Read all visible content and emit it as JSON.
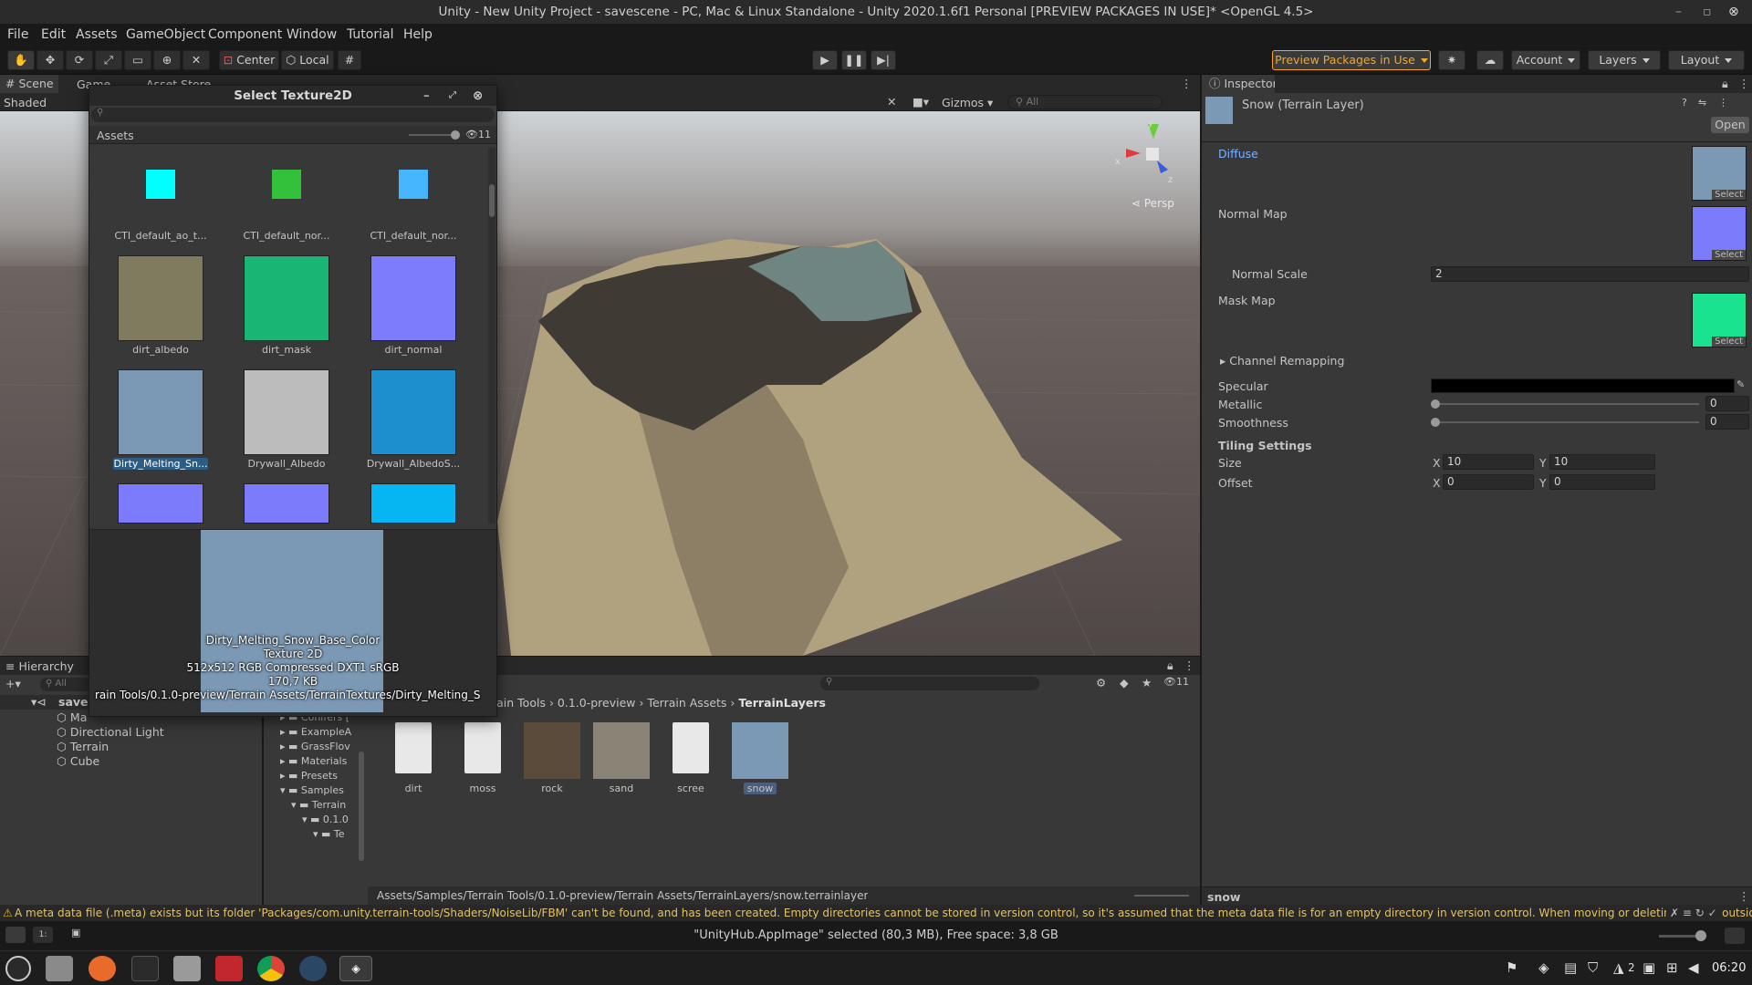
{
  "window": {
    "title": "Unity - New Unity Project - savescene - PC, Mac & Linux Standalone - Unity 2020.1.6f1 Personal [PREVIEW PACKAGES IN USE]* <OpenGL 4.5>"
  },
  "menu": [
    "File",
    "Edit",
    "Assets",
    "GameObject",
    "Component",
    "Window",
    "Tutorial",
    "Help"
  ],
  "toolbar": {
    "center_label": "Center",
    "local_label": "Local",
    "preview_packages": "Preview Packages in Use",
    "account": "Account",
    "layers": "Layers",
    "layout": "Layout",
    "accent": "#f5a623"
  },
  "scene": {
    "tabs": [
      "Scene",
      "Game",
      "Asset Store"
    ],
    "shading": "Shaded",
    "gizmos": "Gizmos",
    "search_placeholder": "All",
    "persp": "Persp",
    "axis_x": "x",
    "axis_y": "y",
    "axis_z": "z"
  },
  "dialog": {
    "title": "Select Texture2D",
    "tab": "Assets",
    "count": "11",
    "items": [
      {
        "label": "CTI_default_ao_t...",
        "color": "#00ffff"
      },
      {
        "label": "CTI_default_nor...",
        "color": "#33c13b"
      },
      {
        "label": "CTI_default_nor...",
        "color": "#45b6ff"
      },
      {
        "label": "dirt_albedo",
        "color": "#807a5f"
      },
      {
        "label": "dirt_mask",
        "color": "#19b574"
      },
      {
        "label": "dirt_normal",
        "color": "#7d7cfc"
      },
      {
        "label": "Dirty_Melting_Sn...",
        "color": "#7b98b4"
      },
      {
        "label": "Drywall_Albedo",
        "color": "#bcbcbc"
      },
      {
        "label": "Drywall_AlbedoS...",
        "color": "#1d8fcf"
      },
      {
        "label": "",
        "color": "#7b7bfb"
      },
      {
        "label": "",
        "color": "#7b7bfb"
      },
      {
        "label": "",
        "color": "#06b6f2"
      }
    ],
    "preview": {
      "name": "Dirty_Melting_Snow_Base_Color",
      "type": "Texture 2D",
      "info": "512x512  RGB Compressed DXT1 sRGB",
      "size": "170,7 KB",
      "path": "rain Tools/0.1.0-preview/Terrain Assets/TerrainTextures/Dirty_Melting_S"
    }
  },
  "inspector": {
    "tab": "Inspector",
    "object_name": "Snow (Terrain Layer)",
    "open_button": "Open",
    "diffuse": "Diffuse",
    "normal_map": "Normal Map",
    "normal_scale_label": "Normal Scale",
    "normal_scale": "2",
    "mask_map": "Mask Map",
    "channel_remapping": "Channel Remapping",
    "specular": "Specular",
    "metallic": "Metallic",
    "metallic_value": "0",
    "smoothness": "Smoothness",
    "smoothness_value": "0",
    "tiling_settings": "Tiling Settings",
    "size_label": "Size",
    "size_x": "10",
    "size_y": "10",
    "offset_label": "Offset",
    "offset_x": "0",
    "offset_y": "0",
    "x": "X",
    "y": "Y",
    "select": "Select",
    "footer": "snow"
  },
  "hierarchy": {
    "tab": "Hierarchy",
    "search_placeholder": "All",
    "root": "saves",
    "items": [
      "Ma",
      "Directional Light",
      "Terrain",
      "Cube"
    ]
  },
  "project": {
    "breadcrumb": [
      "rain Tools",
      "0.1.0-preview",
      "Terrain Assets",
      "TerrainLayers"
    ],
    "tree": [
      "Conifers [",
      "ExampleA",
      "GrassFlov",
      "Materials",
      "Presets",
      "Samples",
      "Terrain",
      "0.1.0",
      "Te"
    ],
    "count": "11",
    "assets": [
      {
        "label": "dirt"
      },
      {
        "label": "moss"
      },
      {
        "label": "rock"
      },
      {
        "label": "sand"
      },
      {
        "label": "scree"
      },
      {
        "label": "snow"
      }
    ],
    "path": "Assets/Samples/Terrain Tools/0.1.0-preview/Terrain Assets/TerrainLayers/snow.terrainlayer"
  },
  "console": {
    "message": "A meta data file (.meta) exists but its folder 'Packages/com.unity.terrain-tools/Shaders/NoiseLib/FBM' can't be found, and has been created. Empty directories cannot be stored in version control, so it's assumed that the meta data file is for an empty directory in version control. When moving or deleting folders outside of Unit"
  },
  "status": {
    "text": "\"UnityHub.AppImage\" selected (80,3 MB), Free space: 3,8 GB"
  },
  "taskbar": {
    "clock": "06:20",
    "workspace": "2"
  }
}
